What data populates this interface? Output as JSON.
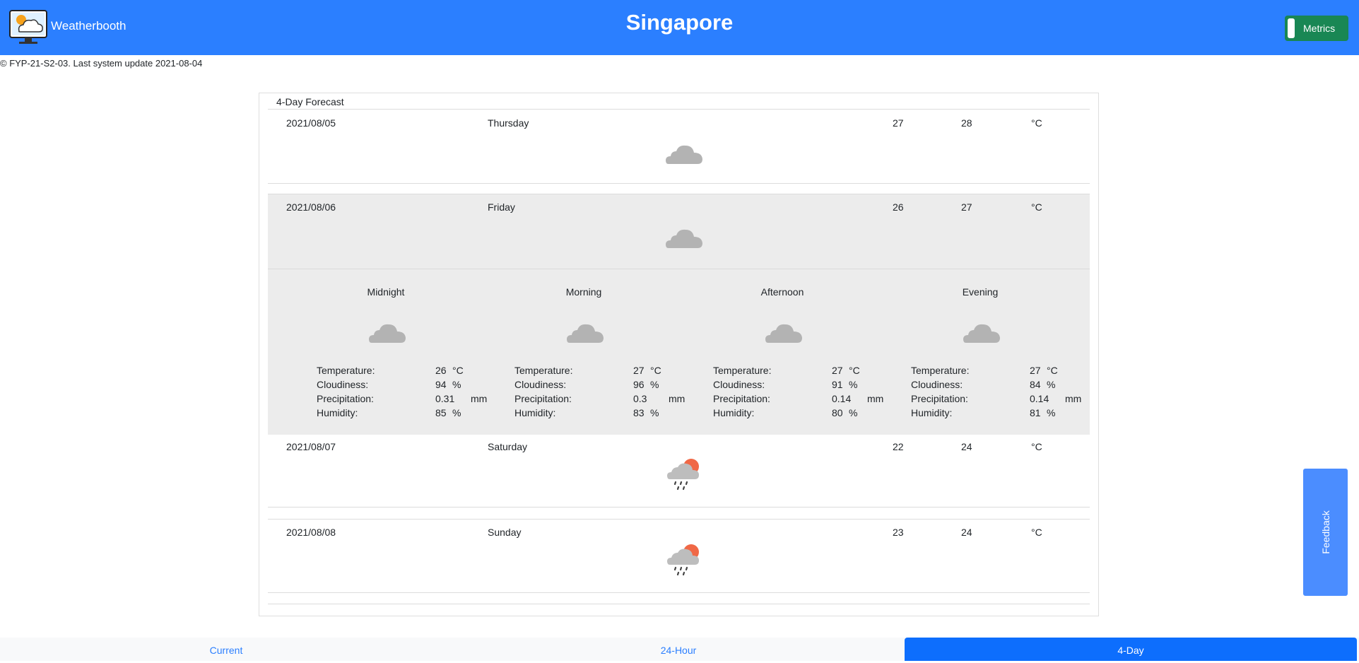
{
  "header": {
    "app_name": "Weatherbooth",
    "city": "Singapore",
    "metrics_label": "Metrics"
  },
  "footer_note": "© FYP-21-S2-03. Last system update 2021-08-04",
  "forecast": {
    "title": "4-Day Forecast",
    "days": [
      {
        "date": "2021/08/05",
        "day": "Thursday",
        "min": "27",
        "max": "28",
        "unit": "°C",
        "icon": "cloud-icon"
      },
      {
        "date": "2021/08/06",
        "day": "Friday",
        "min": "26",
        "max": "27",
        "unit": "°C",
        "icon": "cloud-icon"
      },
      {
        "date": "2021/08/07",
        "day": "Saturday",
        "min": "22",
        "max": "24",
        "unit": "°C",
        "icon": "showers-sun-icon"
      },
      {
        "date": "2021/08/08",
        "day": "Sunday",
        "min": "23",
        "max": "24",
        "unit": "°C",
        "icon": "showers-sun-icon"
      }
    ],
    "labels": {
      "temperature": "Temperature:",
      "cloudiness": "Cloudiness:",
      "precipitation": "Precipitation:",
      "humidity": "Humidity:",
      "unit_c": "°C",
      "unit_pct": "%",
      "unit_mm": "mm"
    },
    "periods": [
      {
        "name": "Midnight",
        "icon": "cloud-icon",
        "temperature": "26",
        "cloudiness": "94",
        "precipitation": "0.31",
        "humidity": "85"
      },
      {
        "name": "Morning",
        "icon": "cloud-icon",
        "temperature": "27",
        "cloudiness": "96",
        "precipitation": "0.3",
        "humidity": "83"
      },
      {
        "name": "Afternoon",
        "icon": "cloud-icon",
        "temperature": "27",
        "cloudiness": "91",
        "precipitation": "0.14",
        "humidity": "80"
      },
      {
        "name": "Evening",
        "icon": "cloud-icon",
        "temperature": "27",
        "cloudiness": "84",
        "precipitation": "0.14",
        "humidity": "81"
      }
    ]
  },
  "tabs": [
    {
      "label": "Current",
      "active": false
    },
    {
      "label": "24-Hour",
      "active": false
    },
    {
      "label": "4-Day",
      "active": true
    }
  ],
  "feedback_label": "Feedback",
  "colors": {
    "header": "#2b7fff",
    "metrics_button": "#198754",
    "active_tab": "#0d6efd",
    "feedback": "#4b8dff",
    "sun": "#f06846",
    "cloud": "#b3b3b3"
  }
}
